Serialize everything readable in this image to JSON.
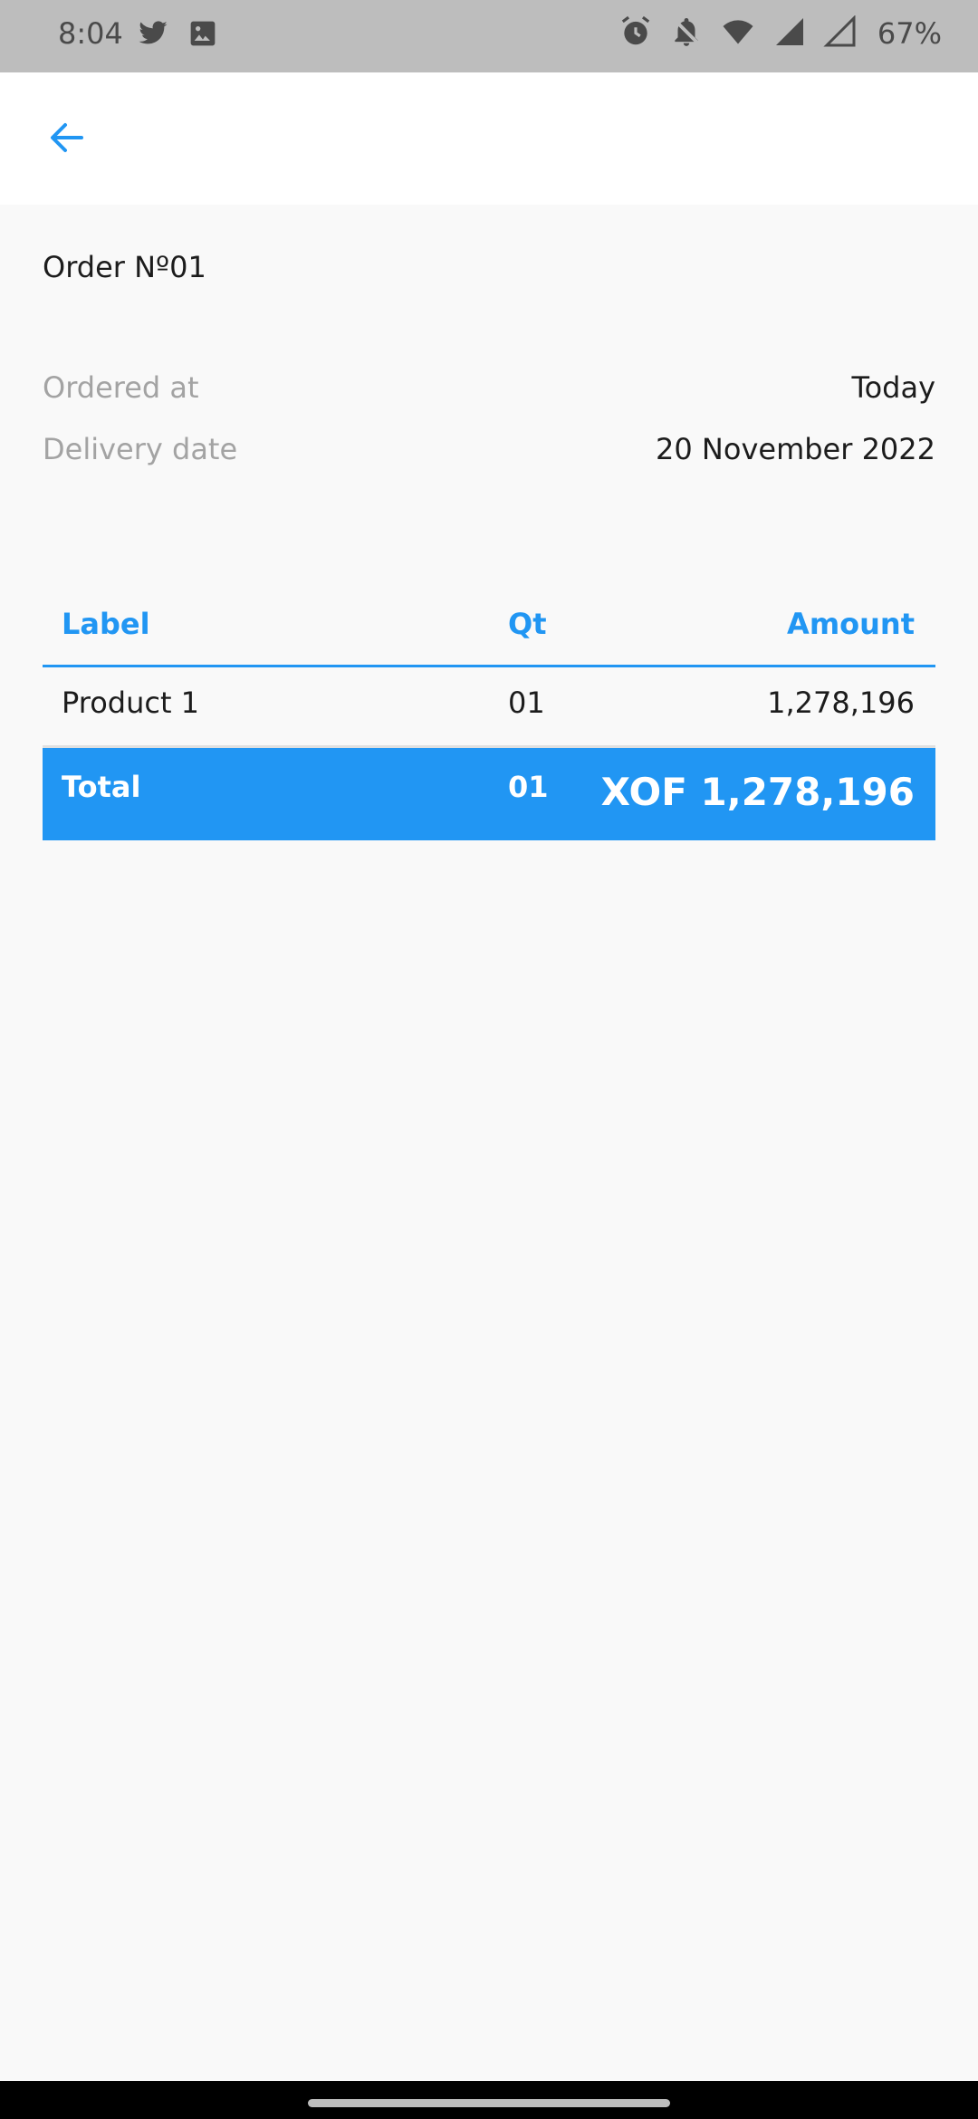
{
  "status_bar": {
    "time": "8:04",
    "battery": "67%",
    "icons": [
      "twitter-icon",
      "image-icon",
      "alarm-icon",
      "notifications-off-icon",
      "wifi-icon",
      "signal-icon",
      "signal-icon"
    ]
  },
  "app_bar": {
    "back_icon": "arrow-left-icon"
  },
  "order": {
    "title": "Order Nº01",
    "ordered_at_label": "Ordered at",
    "ordered_at_value": "Today",
    "delivery_label": "Delivery date",
    "delivery_value": "20 November 2022"
  },
  "table": {
    "headers": {
      "label": "Label",
      "qt": "Qt",
      "amount": "Amount"
    },
    "rows": [
      {
        "label": "Product 1",
        "qt": "01",
        "amount": "1,278,196"
      }
    ],
    "total": {
      "label": "Total",
      "qt": "01",
      "amount": "XOF 1,278,196"
    }
  },
  "colors": {
    "accent": "#2196f3",
    "status_bar": "#bdbdbd",
    "background": "#f9f9f9"
  }
}
